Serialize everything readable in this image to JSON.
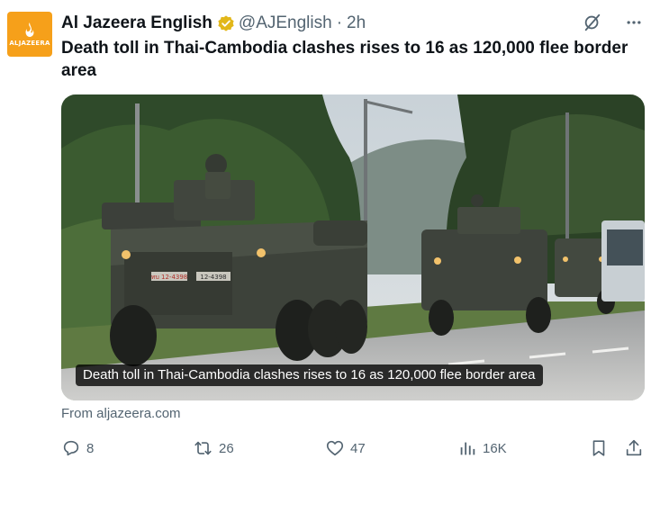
{
  "account": {
    "display_name": "Al Jazeera English",
    "handle": "@AJEnglish",
    "separator": "·",
    "time": "2h",
    "avatar_text": "ALJAZEERA"
  },
  "tweet": {
    "text": "Death toll in Thai-Cambodia clashes rises to 16 as 120,000 flee border area"
  },
  "card": {
    "title": "Death toll in Thai-Cambodia clashes rises to 16 as 120,000 flee border area",
    "source": "From aljazeera.com",
    "vehicle_plate_left": "ทบ 12-4398",
    "vehicle_plate_right": "12-4398"
  },
  "actions": {
    "replies": "8",
    "reposts": "26",
    "likes": "47",
    "views": "16K"
  },
  "colors": {
    "brand_orange": "#f6a01a",
    "verified_gold": "#e2b719",
    "text_secondary": "#536471"
  },
  "icons": {
    "verified": "verified-badge-icon",
    "grok": "grok-icon",
    "more": "more-icon",
    "reply": "reply-icon",
    "repost": "repost-icon",
    "like": "like-icon",
    "views": "views-icon",
    "bookmark": "bookmark-icon",
    "share": "share-icon"
  }
}
